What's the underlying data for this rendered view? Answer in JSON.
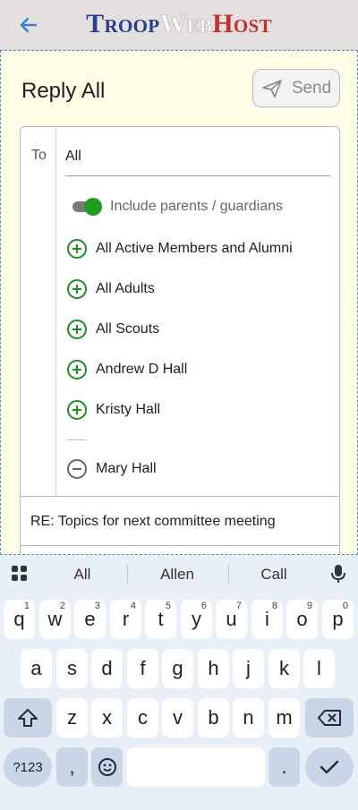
{
  "header": {
    "brand_troop": "Troop",
    "brand_web": "Web",
    "brand_host": "Host",
    "back_icon": "arrow-left-icon"
  },
  "compose": {
    "title": "Reply All",
    "send_label": "Send",
    "to_label": "To",
    "to_value": "All",
    "include_parents_label": "Include parents / guardians",
    "include_parents_on": true,
    "recipients_add": [
      "All Active Members and Alumni",
      "All Adults",
      "All Scouts",
      "Andrew D Hall",
      "Kristy Hall"
    ],
    "recipients_remove": [
      "Mary Hall"
    ],
    "subject": "RE: Topics for next committee meeting"
  },
  "keyboard": {
    "suggestions": [
      "All",
      "Allen",
      "Call"
    ],
    "row1": [
      {
        "k": "q",
        "n": "1"
      },
      {
        "k": "w",
        "n": "2"
      },
      {
        "k": "e",
        "n": "3"
      },
      {
        "k": "r",
        "n": "4"
      },
      {
        "k": "t",
        "n": "5"
      },
      {
        "k": "y",
        "n": "6"
      },
      {
        "k": "u",
        "n": "7"
      },
      {
        "k": "i",
        "n": "8"
      },
      {
        "k": "o",
        "n": "9"
      },
      {
        "k": "p",
        "n": "0"
      }
    ],
    "row2": [
      "a",
      "s",
      "d",
      "f",
      "g",
      "h",
      "j",
      "k",
      "l"
    ],
    "row3": [
      "z",
      "x",
      "c",
      "v",
      "b",
      "n",
      "m"
    ],
    "symbols_label": "?123",
    "comma": ",",
    "period": ".",
    "emoji_icon": "emoji-icon",
    "shift_icon": "shift-icon",
    "backspace_icon": "backspace-icon",
    "enter_icon": "checkmark-icon"
  },
  "colors": {
    "accent_green": "#1e9d1e",
    "brand_blue": "#2b3e8d",
    "brand_red": "#c1312e",
    "content_bg": "#fefee6"
  }
}
